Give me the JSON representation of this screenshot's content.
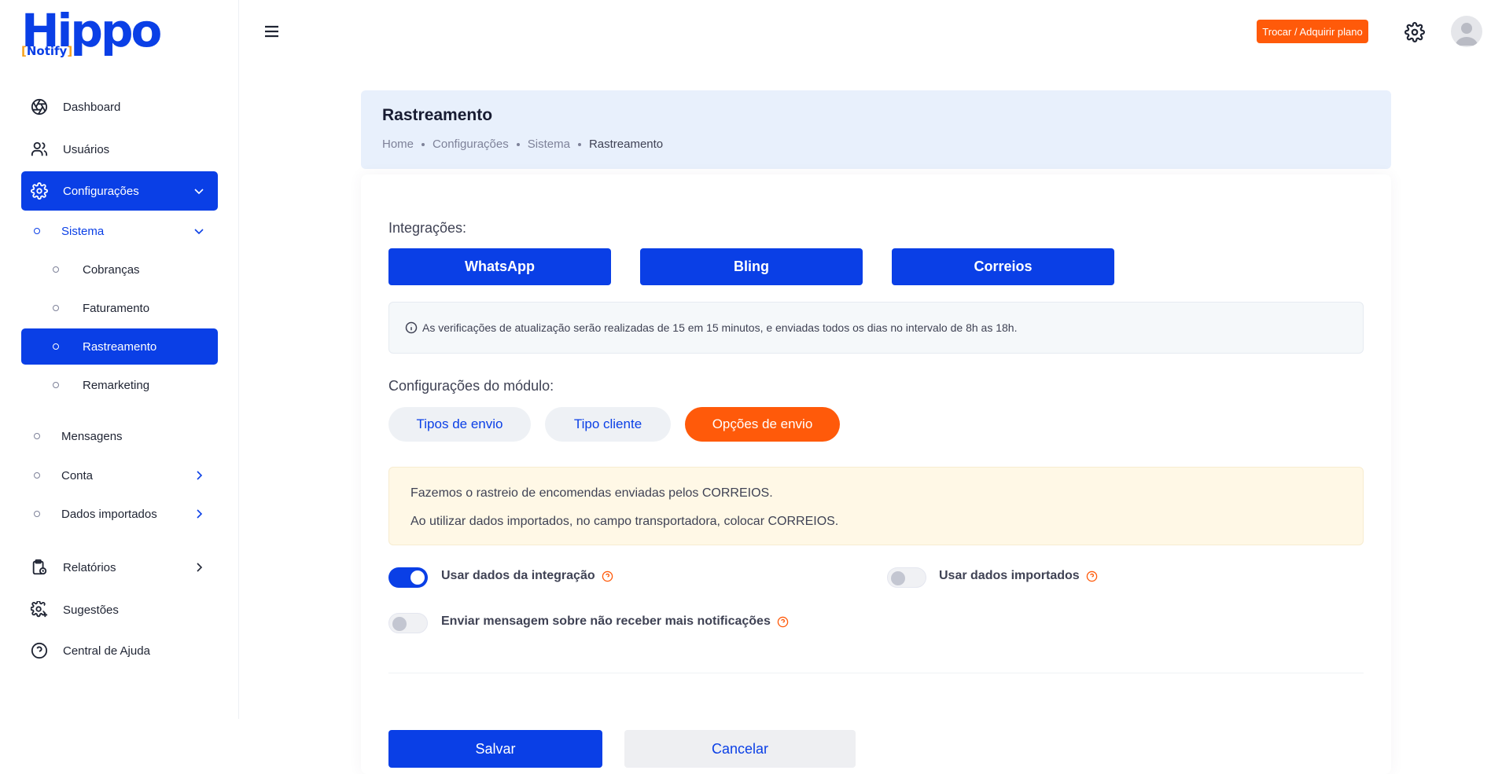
{
  "brand": {
    "name": "Hippo",
    "sub_open": "[",
    "sub_text": "Notify",
    "sub_close": "]"
  },
  "sidebar": {
    "items": [
      {
        "label": "Dashboard",
        "icon": "aperture-icon"
      },
      {
        "label": "Usuários",
        "icon": "users-icon"
      },
      {
        "label": "Configurações",
        "icon": "gear-icon"
      }
    ],
    "sistema": {
      "label": "Sistema"
    },
    "sistema_items": [
      {
        "label": "Cobranças"
      },
      {
        "label": "Faturamento"
      },
      {
        "label": "Rastreamento"
      },
      {
        "label": "Remarketing"
      }
    ],
    "config_items": [
      {
        "label": "Mensagens"
      },
      {
        "label": "Conta"
      },
      {
        "label": "Dados importados"
      }
    ],
    "bottom_items": [
      {
        "label": "Relatórios",
        "icon": "clipboard-clock-icon"
      },
      {
        "label": "Sugestões",
        "icon": "gear-plus-icon"
      },
      {
        "label": "Central de Ajuda",
        "icon": "help-circle-icon"
      }
    ]
  },
  "header": {
    "plan_button": "Trocar / Adquirir plano"
  },
  "page": {
    "title": "Rastreamento",
    "breadcrumbs": [
      "Home",
      "Configurações",
      "Sistema",
      "Rastreamento"
    ]
  },
  "integrations": {
    "label": "Integrações:",
    "buttons": [
      "WhatsApp",
      "Bling",
      "Correios"
    ],
    "info": "As verificações de atualização serão realizadas de 15 em 15 minutos, e enviadas todos os dias no intervalo de 8h as 18h."
  },
  "module": {
    "label": "Configurações do módulo:",
    "tabs": [
      "Tipos de envio",
      "Tipo cliente",
      "Opções de envio"
    ],
    "active_tab": "Opções de envio",
    "notice": [
      "Fazemos o rastreio de encomendas enviadas pelos CORREIOS.",
      "Ao utilizar dados importados, no campo transportadora, colocar CORREIOS."
    ],
    "toggles": [
      {
        "label": "Usar dados da integração",
        "on": true
      },
      {
        "label": "Usar dados importados",
        "on": false
      },
      {
        "label": "Enviar mensagem sobre não receber mais notificações",
        "on": false
      }
    ]
  },
  "actions": {
    "save": "Salvar",
    "cancel": "Cancelar"
  },
  "colors": {
    "primary": "#0a3fe6",
    "accent": "#ff5a0a",
    "notice_bg": "#fff8e6"
  }
}
